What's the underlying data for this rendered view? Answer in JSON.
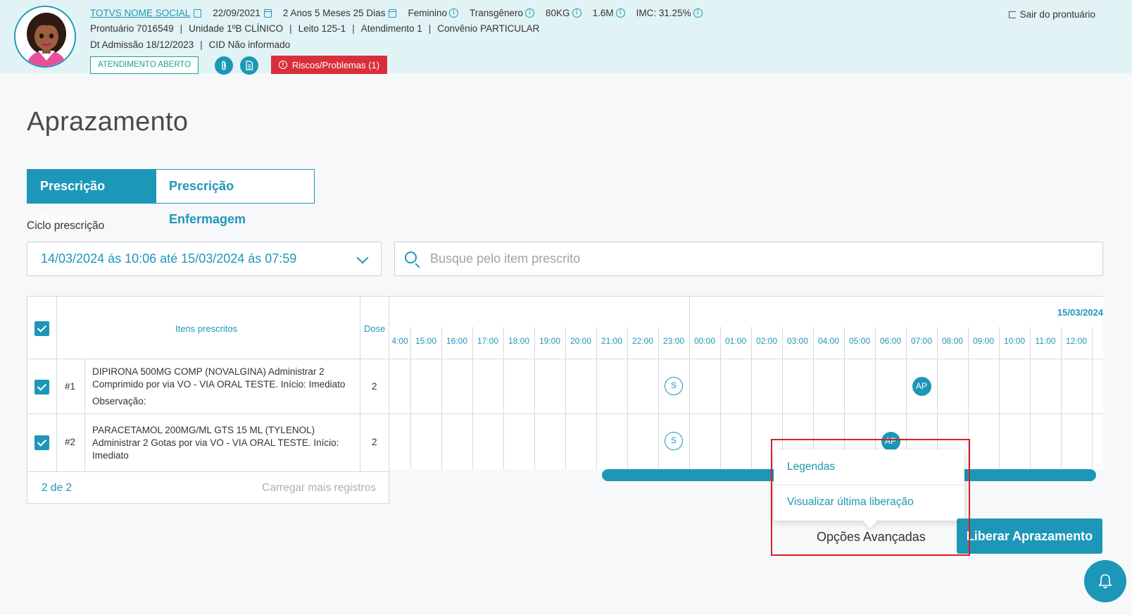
{
  "header": {
    "patient_name": "TOTVS NOME SOCIAL",
    "birth_date": "22/09/2021",
    "age": "2 Anos 5 Meses 25 Dias",
    "sex": "Feminino",
    "gender": "Transgênero",
    "weight": "80KG",
    "height": "1.6M",
    "imc": "IMC: 31.25%",
    "prontuario": "Prontuário 7016549",
    "unidade": "Unidade 1ºB CLÍNICO",
    "leito": "Leito 125-1",
    "atendimento": "Atendimento 1",
    "convenio": "Convênio PARTICULAR",
    "admissao": "Dt Admissão 18/12/2023",
    "cid": "CID Não informado",
    "separator": "|",
    "status_badge": "ATENDIMENTO ABERTO",
    "risks_button": "Riscos/Problemas (1)",
    "logout": "Sair do prontuário",
    "colors": {
      "background": "#e2f3f5",
      "accent": "#1d97b8",
      "status": "#1aa38a",
      "danger": "#d92f3b"
    }
  },
  "page": {
    "title": "Aprazamento"
  },
  "tabs": [
    {
      "label": "Prescrição Médica",
      "active": true
    },
    {
      "label": "Prescrição Enfermagem",
      "active": false
    }
  ],
  "filters": {
    "cycle_label": "Ciclo prescrição",
    "cycle_value": "14/03/2024 ás 10:06 até 15/03/2024 ás 07:59",
    "search_placeholder": "Busque pelo item prescrito"
  },
  "table": {
    "header_items": "Itens prescritos",
    "header_dose": "Dose",
    "date_label": "15/03/2024",
    "hours": [
      "4:00",
      "15:00",
      "16:00",
      "17:00",
      "18:00",
      "19:00",
      "20:00",
      "21:00",
      "22:00",
      "23:00",
      "00:00",
      "01:00",
      "02:00",
      "03:00",
      "04:00",
      "05:00",
      "06:00",
      "07:00",
      "08:00",
      "09:00",
      "10:00",
      "11:00",
      "12:00"
    ],
    "rows": [
      {
        "num": "#1",
        "text": "DIPIRONA 500MG COMP (NOVALGINA) Administrar 2 Comprimido por via VO - VIA ORAL TESTE. Início: Imediato",
        "observation": "Observação:",
        "dose": "2",
        "marks": [
          {
            "hour": "23:00",
            "label": "S"
          },
          {
            "hour": "07:00",
            "label": "AP"
          }
        ]
      },
      {
        "num": "#2",
        "text": "PARACETAMOL 200MG/ML GTS 15 ML (TYLENOL) Administrar 2 Gotas por via VO - VIA ORAL TESTE. Início: Imediato",
        "observation": "",
        "dose": "2",
        "marks": [
          {
            "hour": "23:00",
            "label": "S"
          },
          {
            "hour": "06:00",
            "label": "AP"
          }
        ]
      }
    ],
    "count": "2 de 2",
    "load_more": "Carregar mais registros"
  },
  "advanced": {
    "menu_items": [
      "Legendas",
      "Visualizar última liberação"
    ],
    "button_label": "Opções Avançadas"
  },
  "actions": {
    "release": "Liberar Aprazamento"
  }
}
